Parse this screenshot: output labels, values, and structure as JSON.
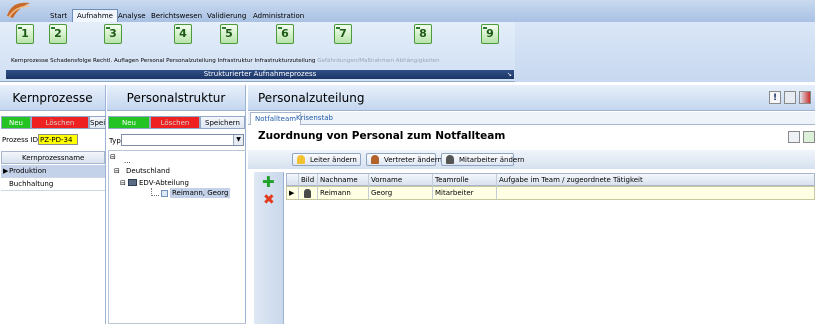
{
  "menu": {
    "tabs": [
      {
        "label": "Start"
      },
      {
        "label": "Aufnahme"
      },
      {
        "label": "Analyse"
      },
      {
        "label": "Berichtswesen"
      },
      {
        "label": "Validierung"
      },
      {
        "label": "Administration"
      }
    ]
  },
  "ribbon": {
    "buttons": [
      {
        "num": "1",
        "label": "Kernprozesse"
      },
      {
        "num": "2",
        "label": "Schadensfolge"
      },
      {
        "num": "3",
        "label": "Rechtl. Auflagen"
      },
      {
        "num": "4",
        "label": "Personal"
      },
      {
        "num": "5",
        "label": "Personalzuteilung"
      },
      {
        "num": "6",
        "label": "Infrastruktur"
      },
      {
        "num": "7",
        "label": "Infrastrukturzuteilung"
      },
      {
        "num": "8",
        "label": "Gefährdungen/Maßnahmen"
      },
      {
        "num": "9",
        "label": "Abhängigkeiten"
      }
    ],
    "group_label": "Strukturierter Aufnahmeprozess"
  },
  "kern": {
    "title": "Kernprozesse",
    "new_label": "Neu",
    "delete_label": "Löschen",
    "save_label": "Spei",
    "process_id_label": "Prozess ID",
    "process_id_value": "PZ-PD-34",
    "column_header": "Kernprozessname",
    "rows": [
      "Produktion",
      "Buchhaltung"
    ]
  },
  "personal": {
    "title": "Personalstruktur",
    "new_label": "Neu",
    "delete_label": "Löschen",
    "save_label": "Speichern",
    "type_label": "Typ",
    "tree": {
      "root": "...",
      "country": "Deutschland",
      "dept": "EDV-Abteilung",
      "person": "Reimann, Georg"
    }
  },
  "zuteilung": {
    "title": "Personalzuteilung",
    "tabs": [
      "Notfallteam",
      "Krisenstab"
    ],
    "subtitle": "Zuordnung von Personal zum Notfallteam",
    "buttons": {
      "leader": "Leiter ändern",
      "deputy": "Vertreter ändern",
      "staff": "Mitarbeiter ändern"
    },
    "columns": [
      "Bild",
      "Nachname",
      "Vorname",
      "Teamrolle",
      "Aufgabe im Team / zugeordnete Tätigkeit"
    ],
    "rows": [
      {
        "nachname": "Reimann",
        "vorname": "Georg",
        "rolle": "Mitarbeiter",
        "aufgabe": ""
      }
    ]
  },
  "colors": {
    "accent": "#1d3566",
    "new": "#22c322",
    "delete": "#ee2020",
    "id_highlight": "#ffff00"
  }
}
